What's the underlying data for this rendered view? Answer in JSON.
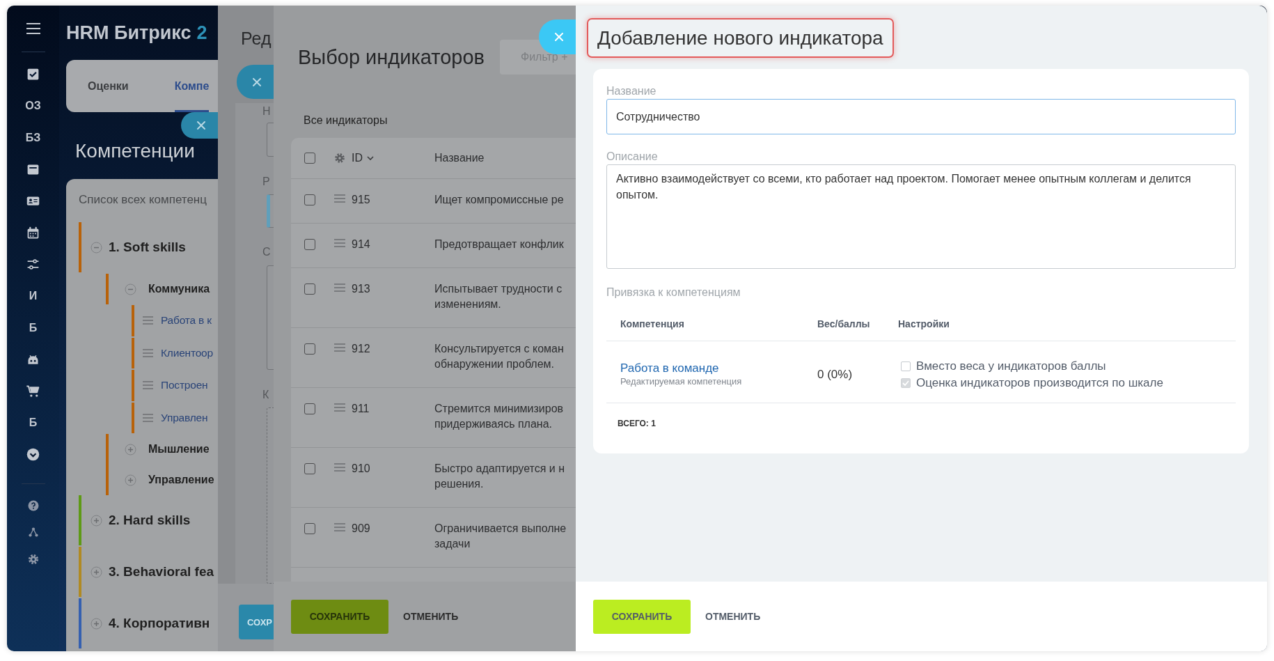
{
  "sidebar": {
    "items": [
      {
        "kind": "icon"
      },
      {
        "kind": "text",
        "label": "ОЗ"
      },
      {
        "kind": "text",
        "label": "БЗ"
      },
      {
        "kind": "icon"
      },
      {
        "kind": "icon"
      },
      {
        "kind": "icon"
      },
      {
        "kind": "icon"
      },
      {
        "kind": "text",
        "label": "И"
      },
      {
        "kind": "text",
        "label": "Б"
      },
      {
        "kind": "icon"
      },
      {
        "kind": "icon"
      },
      {
        "kind": "text",
        "label": "Б"
      },
      {
        "kind": "icon"
      }
    ],
    "bottom_items": [
      {
        "kind": "icon"
      },
      {
        "kind": "icon"
      },
      {
        "kind": "icon"
      }
    ]
  },
  "app": {
    "logo": {
      "name": "HRM Битрикс",
      "suffix": "2"
    },
    "tabs": [
      {
        "label": "Оценки",
        "selected": false
      },
      {
        "label": "Компе",
        "selected": true
      }
    ],
    "title": "Компетенции",
    "list_title": "Список всех компетенц",
    "tree": [
      {
        "label": "1. Soft skills",
        "kind": "group",
        "expanded": true,
        "color": "#b8620a",
        "children": [
          {
            "label": "Коммуника",
            "kind": "group",
            "expanded": true,
            "children": [
              {
                "label": "Работа в к",
                "kind": "item"
              },
              {
                "label": "Клиентоор",
                "kind": "item"
              },
              {
                "label": "Построен",
                "kind": "item"
              },
              {
                "label": "Управлен",
                "kind": "item"
              }
            ]
          },
          {
            "label": "Мышление",
            "kind": "group",
            "expanded": false
          },
          {
            "label": "Управление",
            "kind": "group",
            "expanded": false
          }
        ]
      },
      {
        "label": "2. Hard skills",
        "kind": "group",
        "expanded": false,
        "color": "#5e9a16"
      },
      {
        "label": "3. Behavioral fea",
        "kind": "group",
        "expanded": false,
        "color": "#b08a23"
      },
      {
        "label": "4. Корпоративн",
        "kind": "group",
        "expanded": false,
        "color": "#3560b0"
      }
    ]
  },
  "edit_panel": {
    "title": "Ред",
    "field_labels": [
      "Н",
      "Р",
      "С",
      "К"
    ],
    "save": "СОХР"
  },
  "picker": {
    "title": "Выбор индикаторов",
    "all_checked": false,
    "filter_placeholder": "Фильтр +",
    "section": "Все индикаторы",
    "columns": [
      "ID",
      "Название"
    ],
    "rows": [
      {
        "id": "915",
        "name": [
          "Ищет компромиссные ре"
        ],
        "checked": false
      },
      {
        "id": "914",
        "name": [
          "Предотвращает конфлик"
        ],
        "checked": false
      },
      {
        "id": "913",
        "name": [
          "Испытывает трудности с",
          "изменениям."
        ],
        "checked": false
      },
      {
        "id": "912",
        "name": [
          "Консультируется с коман",
          "обнаружении проблем."
        ],
        "checked": false
      },
      {
        "id": "911",
        "name": [
          "Стремится минимизиров",
          "придерживаясь плана."
        ],
        "checked": false
      },
      {
        "id": "910",
        "name": [
          "Быстро адаптируется и н",
          "решения."
        ],
        "checked": false
      },
      {
        "id": "909",
        "name": [
          "Ограничивается выполне",
          "задачи"
        ],
        "checked": false
      }
    ],
    "save": "СОХРАНИТЬ",
    "cancel": "ОТМЕНИТЬ"
  },
  "form": {
    "title": "Добавление нового индикатора",
    "highlighted": true,
    "name_label": "Название",
    "name_value": "Сотрудничество",
    "description_label": "Описание",
    "description_value": "Активно взаимодействует со всеми, кто работает над проектом. Помогает менее опытным коллегам и делится опытом.",
    "binding_label": "Привязка к компетенциям",
    "columns": [
      "Компетенция",
      "Вес/баллы",
      "Настройки"
    ],
    "rows": [
      {
        "name": "Работа в команде",
        "note": "Редактируемая компетенция",
        "weight": "0 (0%)",
        "options": [
          {
            "label": "Вместо веса у индикаторов баллы",
            "checked": false,
            "disabled": false
          },
          {
            "label": "Оценка индикаторов производится по шкале",
            "checked": true,
            "disabled": true
          }
        ]
      }
    ],
    "total": "ВСЕГО: 1",
    "save": "СОХРАНИТЬ",
    "cancel": "ОТМЕНИТЬ"
  }
}
